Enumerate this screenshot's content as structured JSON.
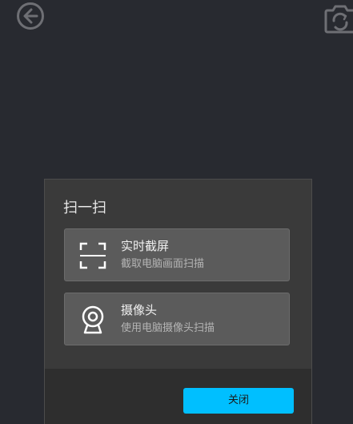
{
  "toolbar": {
    "back_icon": "arrow-left-circle-icon",
    "rotate_icon": "camera-rotate-icon"
  },
  "dialog": {
    "title": "扫一扫",
    "options": [
      {
        "title": "实时截屏",
        "description": "截取电脑画面扫描",
        "icon": "scan-frame-icon"
      },
      {
        "title": "摄像头",
        "description": "使用电脑摄像头扫描",
        "icon": "webcam-icon"
      }
    ],
    "close_label": "关闭"
  },
  "colors": {
    "background": "#282a30",
    "dialog": "#3a3a3a",
    "option": "#5b5b5b",
    "footer": "#2e2e2e",
    "accent": "#00bfff"
  }
}
